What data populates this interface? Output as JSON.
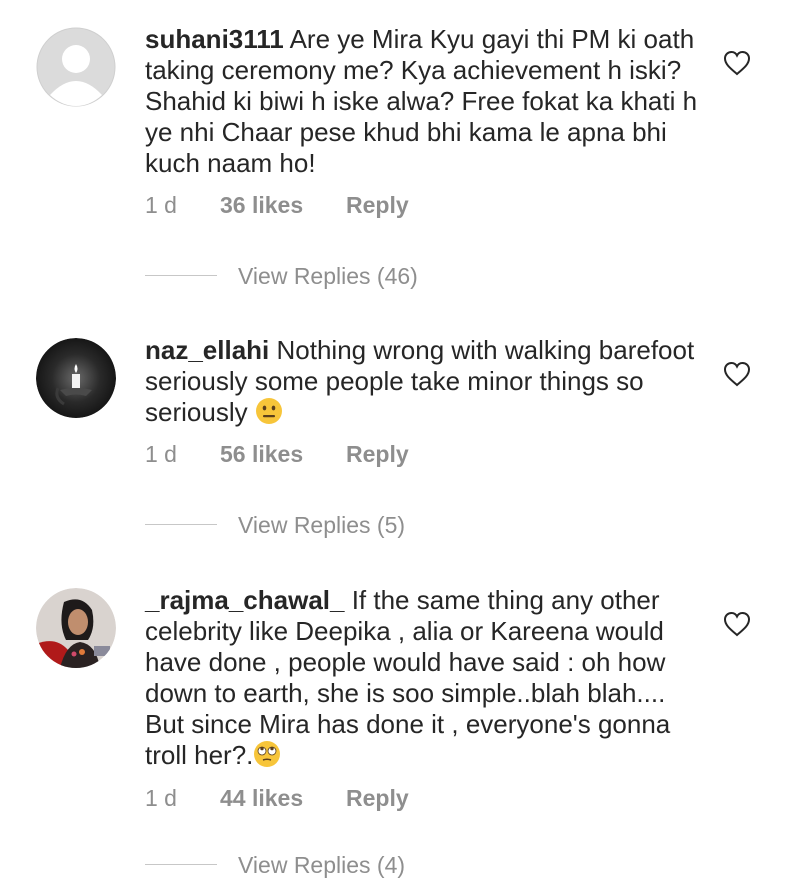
{
  "comments": [
    {
      "username": "suhani3111",
      "text": "Are ye Mira Kyu gayi thi PM ki oath taking ceremony me? Kya achievement h iski? Shahid ki biwi h iske alwa? Free fokat ka khati h ye nhi Chaar pese khud bhi kama le apna bhi kuch naam ho!",
      "time": "1 d",
      "likes": "36 likes",
      "reply_label": "Reply",
      "view_replies": "View Replies (46)",
      "avatar": "default-avatar-icon"
    },
    {
      "username": "naz_ellahi",
      "text": "Nothing wrong with walking barefoot seriously some people take minor things so seriously",
      "emoji": "neutral-face-emoji",
      "time": "1 d",
      "likes": "56 likes",
      "reply_label": "Reply",
      "view_replies": "View Replies (5)",
      "avatar": "candle-photo"
    },
    {
      "username": "_rajma_chawal_",
      "text": "If the same thing any other celebrity like Deepika , alia or Kareena would have done , people would have said : oh how down to earth, she is soo simple..blah blah.... But since Mira has done it , everyone's gonna troll her?.",
      "emoji": "eye-roll-emoji",
      "time": "1 d",
      "likes": "44 likes",
      "reply_label": "Reply",
      "view_replies": "View Replies (4)",
      "avatar": "woman-photo"
    }
  ]
}
